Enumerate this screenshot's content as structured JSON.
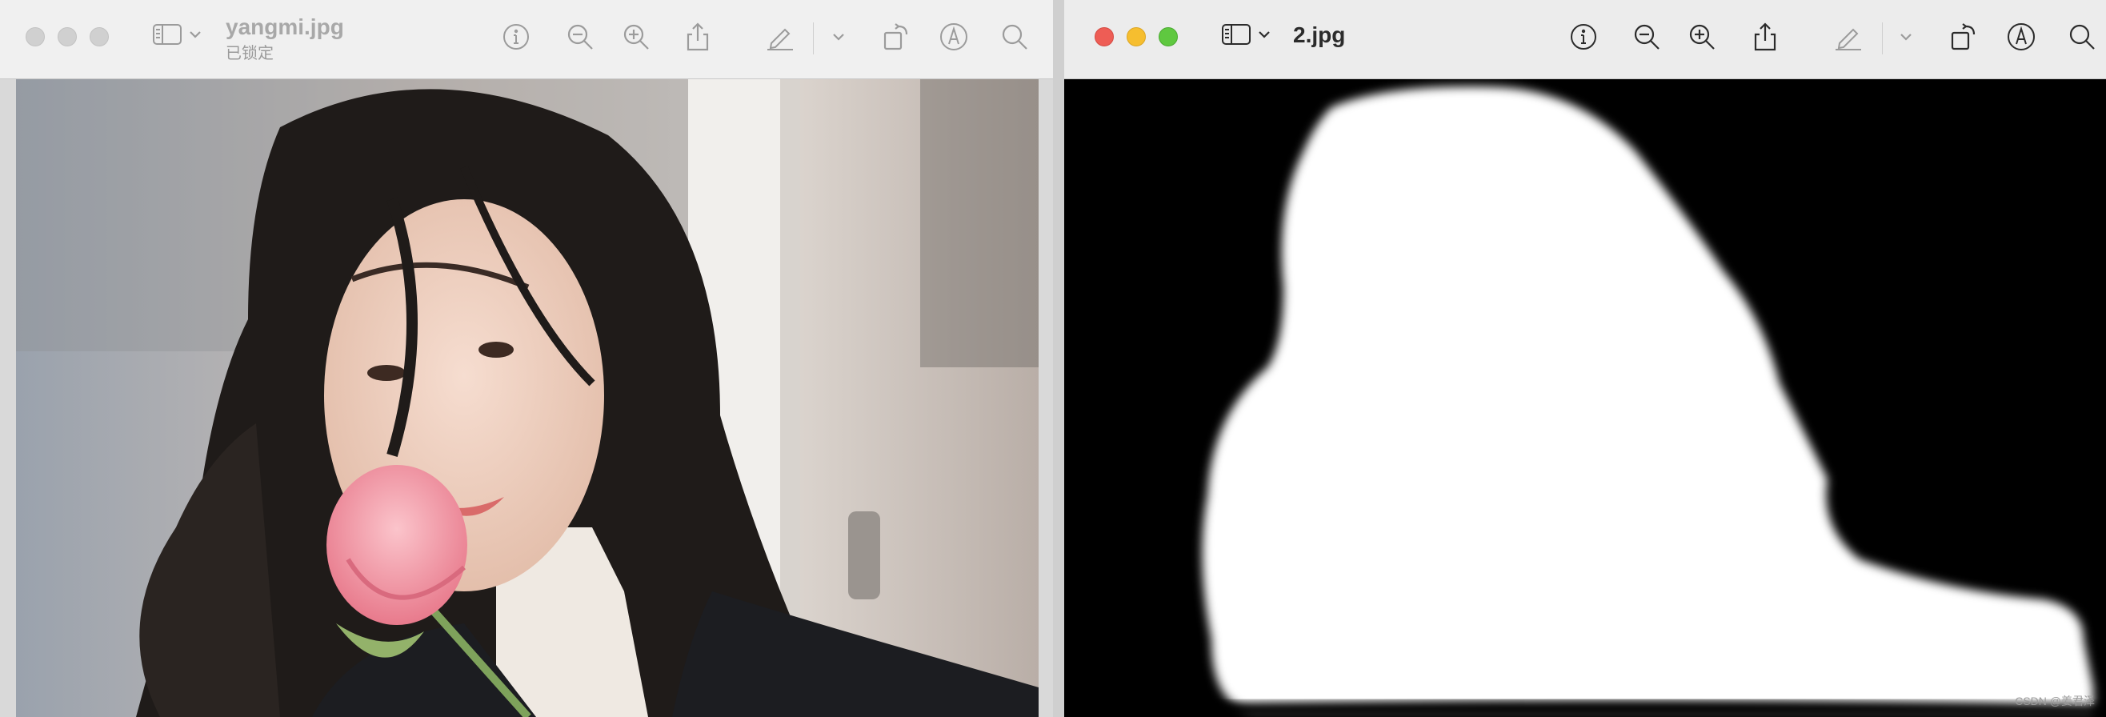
{
  "left_window": {
    "title": "yangmi.jpg",
    "subtitle": "已锁定",
    "state": "inactive",
    "toolbar_icons": [
      "sidebar-icon",
      "chevron-down-icon",
      "info-icon",
      "zoom-out-icon",
      "zoom-in-icon",
      "share-icon",
      "markup-pen-icon",
      "chevron-down-icon",
      "rotate-icon",
      "markup-icon",
      "search-icon"
    ],
    "image_description_colors": {
      "background": "#cfc7c2",
      "hair": "#1e1a18",
      "jacket": "#1b1c20",
      "turtleneck": "#f2efe9",
      "rose": "#f29aa7"
    }
  },
  "right_window": {
    "title": "2.jpg",
    "state": "active",
    "traffic_colors": {
      "close": "#ee5d55",
      "minimize": "#f6be2f",
      "maximize": "#5fc840"
    },
    "toolbar_icons": [
      "sidebar-icon",
      "chevron-down-icon",
      "info-icon",
      "zoom-out-icon",
      "zoom-in-icon",
      "share-icon",
      "markup-pen-icon",
      "chevron-down-icon",
      "rotate-icon",
      "markup-icon",
      "search-icon"
    ],
    "watermark": "CSDN @姜君泽"
  }
}
